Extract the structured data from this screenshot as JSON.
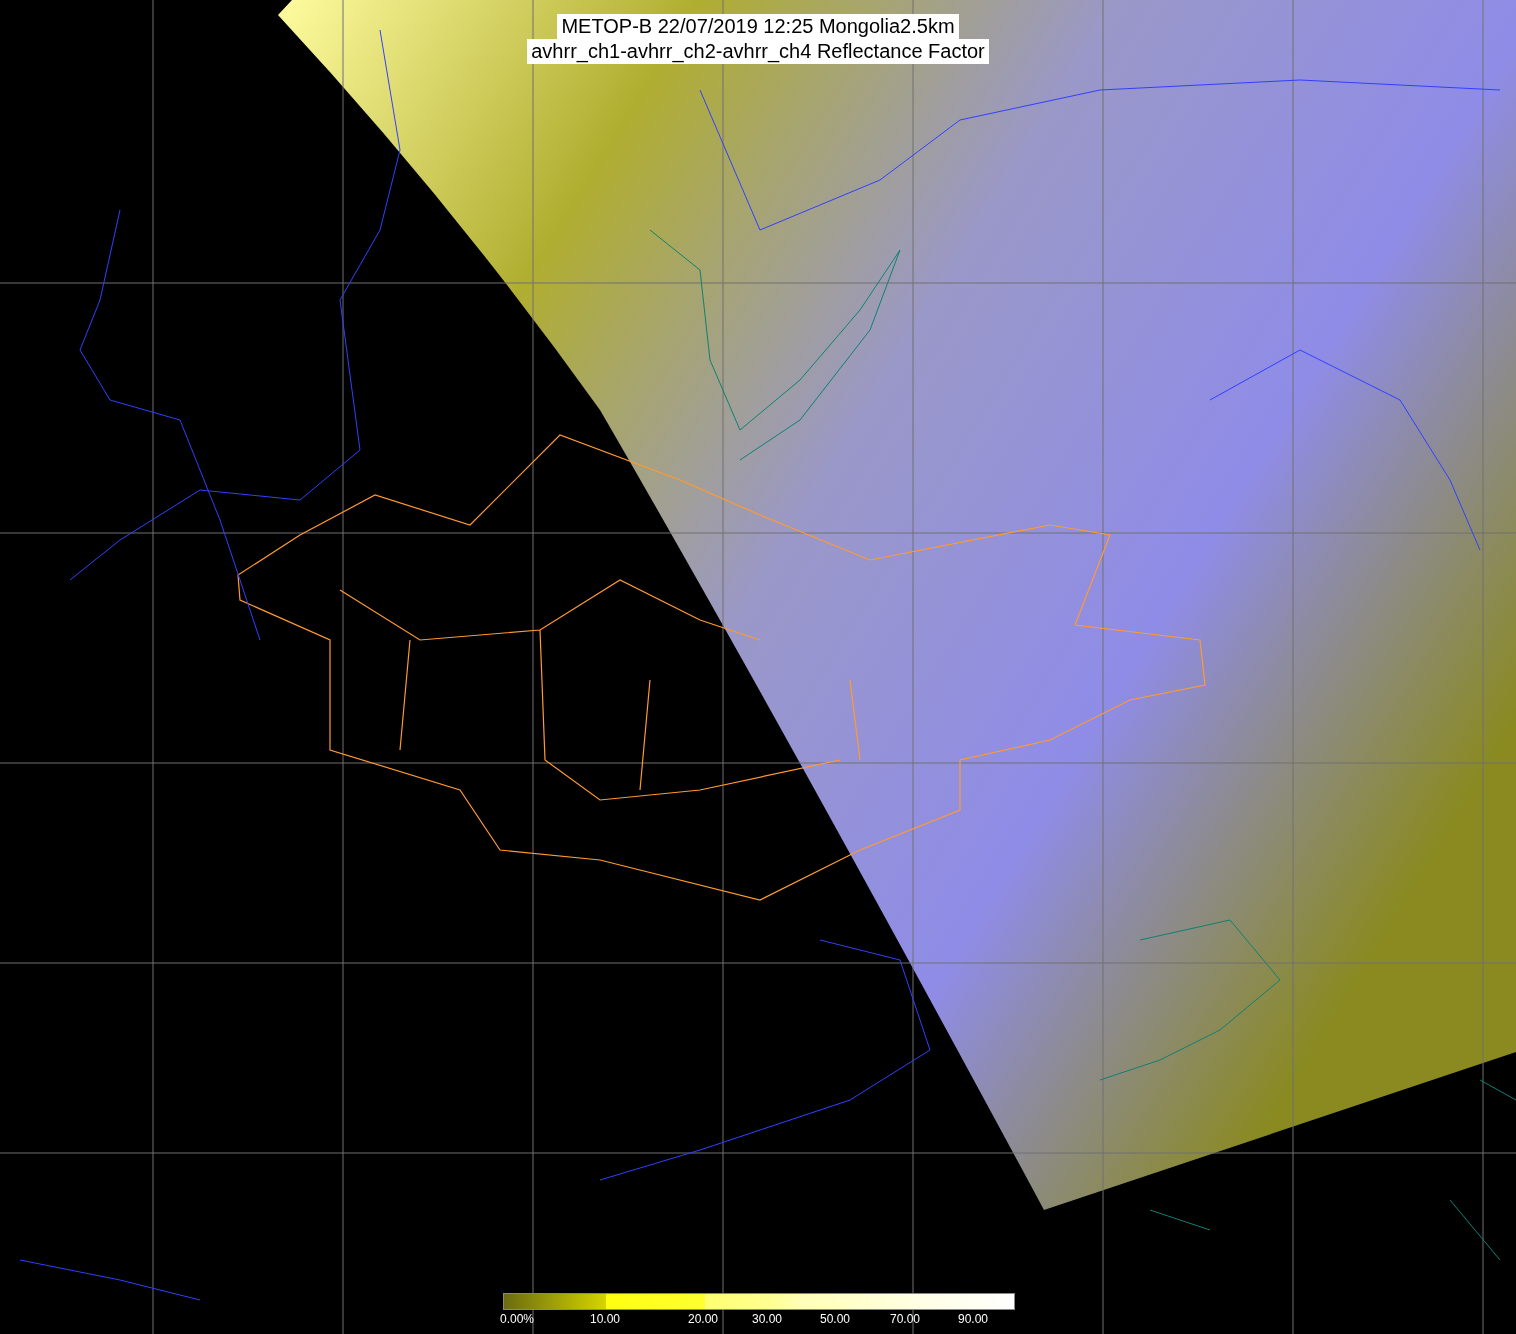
{
  "title": {
    "line_1": "METOP-B 22/07/2019 12:25 Mongolia2.5km",
    "line_2": "avhrr_ch1-avhrr_ch2-avhrr_ch4 Reflectance Factor"
  },
  "colorbar": {
    "labels": [
      "0.00%",
      "10.00",
      "20.00",
      "30.00",
      "50.00",
      "70.00",
      "90.00"
    ]
  }
}
